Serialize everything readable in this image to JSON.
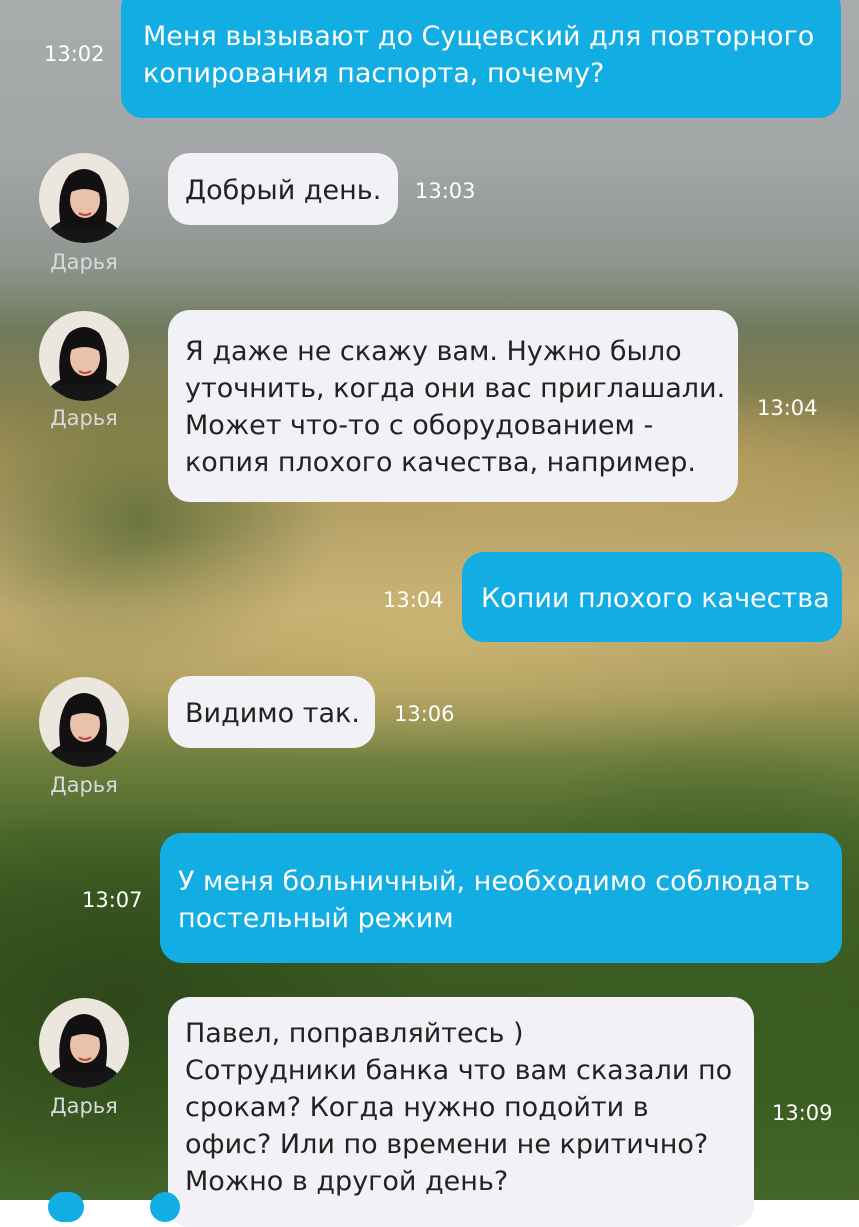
{
  "chat": {
    "messages": [
      {
        "direction": "out",
        "text": "Меня вызывают до Сущевский для повторного\nкопирования паспорта, почему?",
        "time": "13:02"
      },
      {
        "direction": "in",
        "sender": "Дарья",
        "text": "Добрый день.",
        "time": "13:03"
      },
      {
        "direction": "in",
        "sender": "Дарья",
        "text": "Я даже не скажу вам. Нужно было\nуточнить, когда они вас приглашали.\nМожет что-то с оборудованием -\nкопия плохого качества, например.",
        "time": "13:04"
      },
      {
        "direction": "out",
        "text": "Копии плохого качества",
        "time": "13:04"
      },
      {
        "direction": "in",
        "sender": "Дарья",
        "text": "Видимо так.",
        "time": "13:06"
      },
      {
        "direction": "out",
        "text": "У меня больничный, необходимо соблюдать\nпостельный режим",
        "time": "13:07"
      },
      {
        "direction": "in",
        "sender": "Дарья",
        "text": "Павел, поправляйтесь )\nСотрудники банка что вам сказали по\nсрокам? Когда нужно подойти в\nофис? Или по времени не критично?\nМожно в другой день?",
        "time": "13:09"
      }
    ]
  },
  "colors": {
    "outgoing_bubble": "#12ade3",
    "incoming_bubble": "#f2f1f6",
    "timestamp": "#ffffff",
    "sender_name": "#d8dadc"
  },
  "icons": {
    "avatar": "agent-avatar-photo"
  }
}
